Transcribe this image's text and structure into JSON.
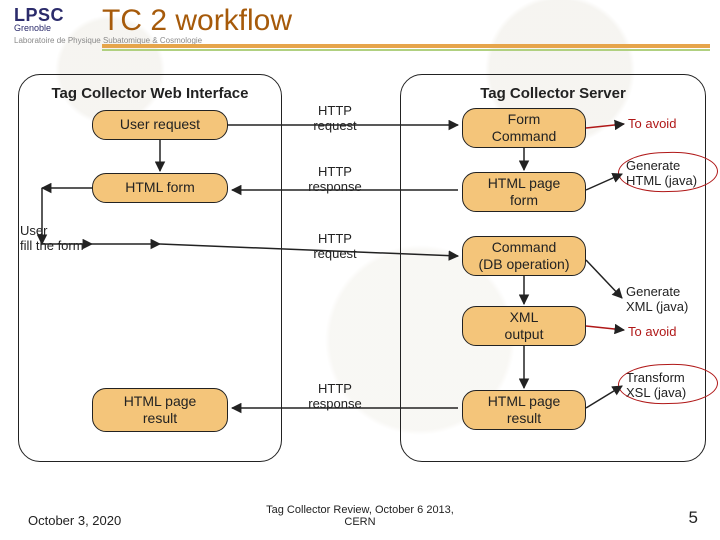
{
  "title": "TC 2 workflow",
  "logo": {
    "top": "LPSC",
    "sub": "Grenoble",
    "subsub": "Laboratoire de Physique Subatomique & Cosmologie"
  },
  "panels": {
    "left_title": "Tag Collector Web Interface",
    "right_title": "Tag Collector Server"
  },
  "left_boxes": {
    "user_request": "User request",
    "html_form": "HTML form",
    "html_page_result": "HTML page\nresult"
  },
  "right_boxes": {
    "form_command": "Form\nCommand",
    "html_page_form": "HTML page\nform",
    "command_db": "Command\n(DB operation)",
    "xml_output": "XML\noutput",
    "html_page_result": "HTML page\nresult"
  },
  "http": {
    "req1": "HTTP\nrequest",
    "resp1": "HTTP\nresponse",
    "req2": "HTTP\nrequest",
    "resp2": "HTTP\nresponse"
  },
  "side_labels": {
    "user_fill": "User\nfill the form",
    "to_avoid1": "To avoid",
    "gen_html": "Generate\nHTML (java)",
    "gen_xml": "Generate\nXML (java)",
    "to_avoid2": "To avoid",
    "xsl": "Transform\nXSL (java)"
  },
  "footer": {
    "date": "October 3, 2020",
    "mid": "Tag Collector Review, October 6 2013,\nCERN",
    "page": "5"
  }
}
